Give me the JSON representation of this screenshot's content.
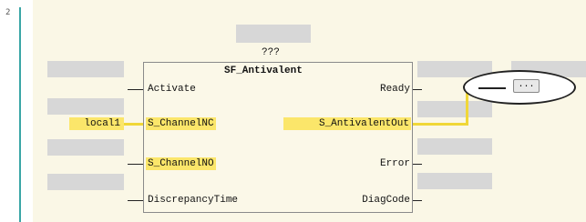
{
  "line_number": "2",
  "function_block": {
    "instance_name": "???",
    "type_name": "SF_Antivalent",
    "inputs": [
      {
        "label": "Activate"
      },
      {
        "label": "S_ChannelNC"
      },
      {
        "label": "S_ChannelNO"
      },
      {
        "label": "DiscrepancyTime"
      }
    ],
    "outputs": [
      {
        "label": "Ready"
      },
      {
        "label": "S_AntivalentOut"
      },
      {
        "label": "Error"
      },
      {
        "label": "DiagCode"
      }
    ]
  },
  "input_variable": "local1",
  "ellipsis_button_label": "...",
  "colors": {
    "highlight": "#fbe66a",
    "wire": "#f0d738",
    "placeholder": "#d7d7d7",
    "gutter_bar": "#3aa6a6"
  }
}
